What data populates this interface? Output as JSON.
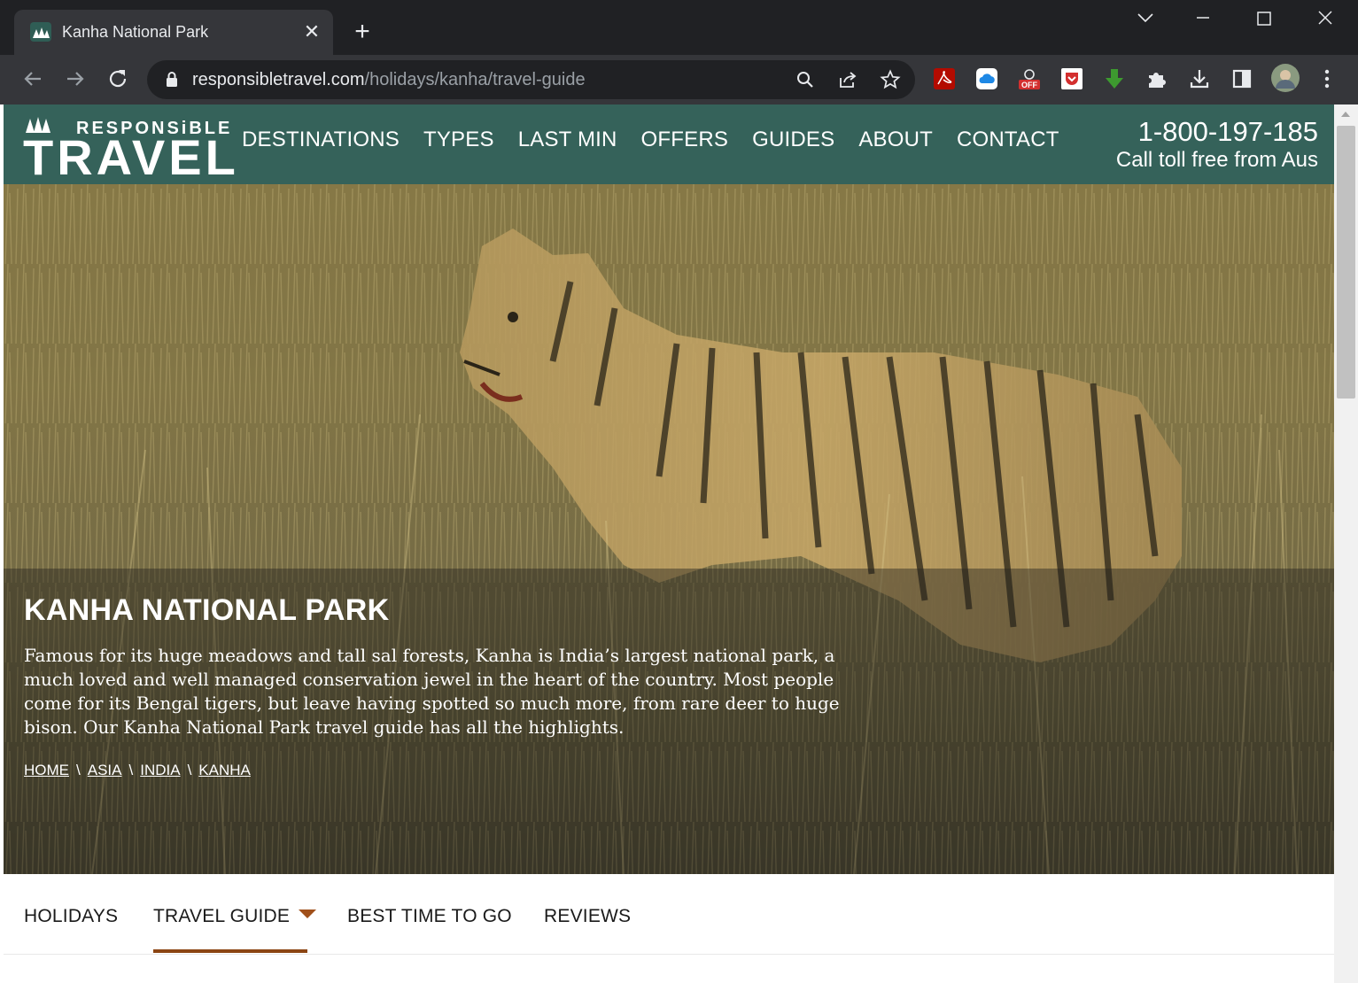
{
  "browser": {
    "tab_title": "Kanha National Park",
    "url_host": "responsibletravel.com",
    "url_path": "/holidays/kanha/travel-guide",
    "extensions": [
      "acrobat-extension-icon",
      "cloud-extension-icon",
      "adblock-off-extension-icon",
      "pocket-extension-icon",
      "download-arrow-extension-icon",
      "puzzle-extensions-icon",
      "download-icon",
      "side-panel-icon",
      "profile-avatar"
    ],
    "adblock_badge": "OFF"
  },
  "header": {
    "logo_small": "RESPONSiBLE",
    "logo_big": "TRAVEL",
    "nav": [
      "DESTINATIONS",
      "TYPES",
      "LAST MIN",
      "OFFERS",
      "GUIDES",
      "ABOUT",
      "CONTACT"
    ],
    "phone_number": "1-800-197-185",
    "phone_note": "Call toll free from Aus"
  },
  "hero": {
    "title": "KANHA NATIONAL PARK",
    "description": "Famous for its huge meadows and tall sal forests, Kanha is India’s largest national park, a much loved and well managed conservation jewel in the heart of the country. Most people come for its Bengal tigers, but leave having spotted so much more, from rare deer to huge bison. Our Kanha National Park travel guide has all the highlights.",
    "breadcrumbs": [
      "HOME",
      "ASIA",
      "INDIA",
      "KANHA"
    ],
    "breadcrumb_separator": "\\"
  },
  "subnav": {
    "items": [
      "HOLIDAYS",
      "TRAVEL GUIDE",
      "BEST TIME TO GO",
      "REVIEWS"
    ],
    "active": "TRAVEL GUIDE"
  },
  "colors": {
    "header_green": "#35625a",
    "active_underline": "#8b4513",
    "chrome_dark": "#202124",
    "chrome_toolbar": "#35363a"
  }
}
